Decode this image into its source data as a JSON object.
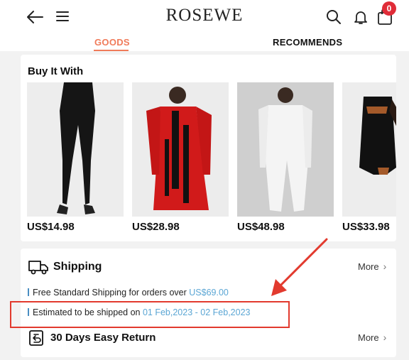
{
  "header": {
    "logo": "ROSEWE",
    "cart_count": "0"
  },
  "tabs": [
    {
      "label": "GOODS",
      "active": true
    },
    {
      "label": "RECOMMENDS",
      "active": false
    }
  ],
  "buy_it_with": {
    "title": "Buy It With",
    "products": [
      {
        "price": "US$14.98"
      },
      {
        "price": "US$28.98"
      },
      {
        "price": "US$48.98"
      },
      {
        "price": "US$33.98"
      }
    ]
  },
  "shipping": {
    "title": "Shipping",
    "more_label": "More",
    "free_shipping_text": "Free Standard Shipping for orders over ",
    "free_shipping_amount": "US$69.00",
    "estimate_text": "Estimated to be shipped on ",
    "estimate_dates": "01 Feb,2023 - 02 Feb,2023"
  },
  "returns": {
    "title": "30 Days Easy Return",
    "more_label": "More"
  },
  "colors": {
    "accent": "#f07b5a",
    "link": "#5ba6d4",
    "badge": "#e02c38",
    "annotation": "#e23a2e"
  }
}
